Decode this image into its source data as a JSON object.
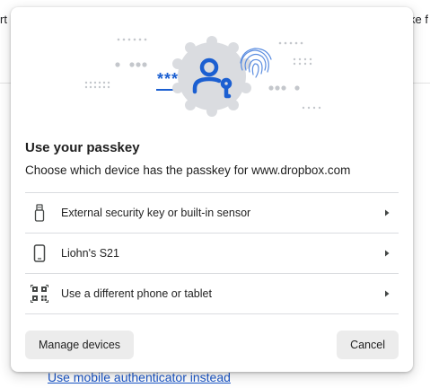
{
  "background": {
    "left_fragment": "rt a",
    "right_fragment": "ke f",
    "link_text": "Use mobile authenticator instead"
  },
  "dialog": {
    "illustration": {
      "password_mask": "***",
      "icons": [
        "passkey-user-icon",
        "fingerprint-icon"
      ]
    },
    "title": "Use your passkey",
    "subtitle": "Choose which device has the passkey for www.dropbox.com",
    "options": [
      {
        "label": "External security key or built-in sensor",
        "icon": "usb-key-icon"
      },
      {
        "label": "Liohn's S21",
        "icon": "phone-icon"
      },
      {
        "label": "Use a different phone or tablet",
        "icon": "qr-code-icon"
      }
    ],
    "manage_button": "Manage devices",
    "cancel_button": "Cancel"
  },
  "colors": {
    "accent": "#1b5fd1",
    "badge": "#dadce0",
    "button_bg": "#ececec",
    "link": "#1a56c8"
  }
}
